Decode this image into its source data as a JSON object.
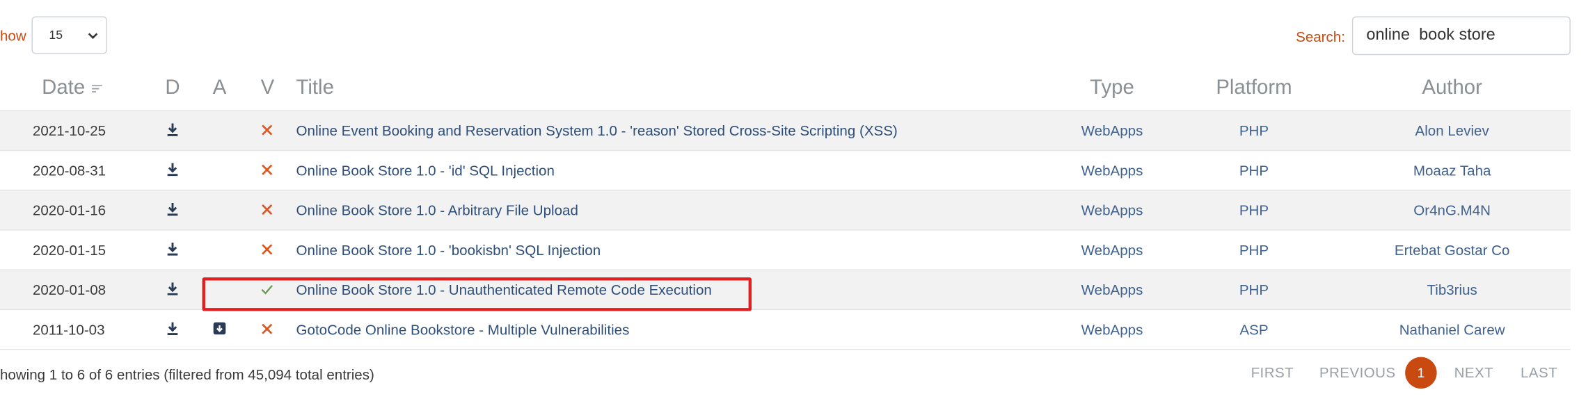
{
  "controls": {
    "show_label": "how",
    "page_length": "15",
    "search_label": "Search:",
    "search_value": "online  book store"
  },
  "columns": {
    "date": "Date",
    "d": "D",
    "a": "A",
    "v": "V",
    "title": "Title",
    "type": "Type",
    "platform": "Platform",
    "author": "Author"
  },
  "rows": [
    {
      "date": "2021-10-25",
      "verified": false,
      "has_app": false,
      "title": "Online Event Booking and Reservation System 1.0 - 'reason' Stored Cross-Site Scripting (XSS)",
      "type": "WebApps",
      "platform": "PHP",
      "author": "Alon Leviev"
    },
    {
      "date": "2020-08-31",
      "verified": false,
      "has_app": false,
      "title": "Online Book Store 1.0 - 'id' SQL Injection",
      "type": "WebApps",
      "platform": "PHP",
      "author": "Moaaz Taha"
    },
    {
      "date": "2020-01-16",
      "verified": false,
      "has_app": false,
      "title": "Online Book Store 1.0 - Arbitrary File Upload",
      "type": "WebApps",
      "platform": "PHP",
      "author": "Or4nG.M4N"
    },
    {
      "date": "2020-01-15",
      "verified": false,
      "has_app": false,
      "title": "Online Book Store 1.0 - 'bookisbn' SQL Injection",
      "type": "WebApps",
      "platform": "PHP",
      "author": "Ertebat Gostar Co"
    },
    {
      "date": "2020-01-08",
      "verified": true,
      "has_app": false,
      "title": "Online Book Store 1.0 - Unauthenticated Remote Code Execution",
      "type": "WebApps",
      "platform": "PHP",
      "author": "Tib3rius"
    },
    {
      "date": "2011-10-03",
      "verified": false,
      "has_app": true,
      "title": "GotoCode Online Bookstore - Multiple Vulnerabilities",
      "type": "WebApps",
      "platform": "ASP",
      "author": "Nathaniel Carew"
    }
  ],
  "footer": {
    "entries_info": "howing 1 to 6 of 6 entries (filtered from 45,094 total entries)",
    "first": "FIRST",
    "previous": "PREVIOUS",
    "current_page": "1",
    "next": "NEXT",
    "last": "LAST"
  },
  "colors": {
    "accent": "#c94a10",
    "link": "#2e4e7a",
    "verified": "#6a9a50",
    "unverified": "#e0531c",
    "highlight": "#e02020"
  },
  "icons": {
    "download": "download-icon",
    "application": "archive-download-icon",
    "verified": "check-icon",
    "unverified": "cross-icon",
    "sort": "sort-icon",
    "select": "chevron-down-icon"
  }
}
